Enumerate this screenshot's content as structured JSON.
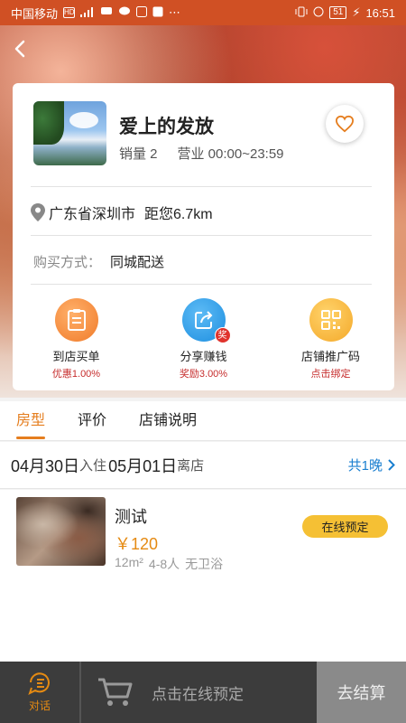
{
  "status_bar": {
    "carrier": "中国移动",
    "battery": "51",
    "time": "16:51"
  },
  "shop": {
    "name": "爱上的发放",
    "sales": "销量 2",
    "hours": "营业 00:00~23:59",
    "address": "广东省深圳市",
    "distance": "距您6.7km",
    "buy_method_label": "购买方式：",
    "buy_method_value": "同城配送"
  },
  "actions": [
    {
      "label": "到店买单",
      "sub": "优惠1.00%"
    },
    {
      "label": "分享赚钱",
      "sub": "奖励3.00%",
      "badge": "奖"
    },
    {
      "label": "店铺推广码",
      "sub": "点击绑定"
    }
  ],
  "tabs": [
    {
      "label": "房型",
      "active": true
    },
    {
      "label": "评价",
      "active": false
    },
    {
      "label": "店铺说明",
      "active": false
    }
  ],
  "dates": {
    "checkin": "04月30日",
    "checkin_hint": "入住",
    "checkout": "05月01日",
    "checkout_hint": "离店",
    "nights": "共1晚"
  },
  "room": {
    "name": "测试",
    "price": "￥120",
    "area": "12m²",
    "people": "4-8人",
    "bath": "无卫浴",
    "book_label": "在线预定"
  },
  "bottom": {
    "chat_label": "对话",
    "cart_hint": "点击在线预定",
    "checkout_label": "去结算"
  },
  "colors": {
    "accent": "#e57e1f",
    "link": "#1a7fd0",
    "book_button": "#f5c034"
  }
}
